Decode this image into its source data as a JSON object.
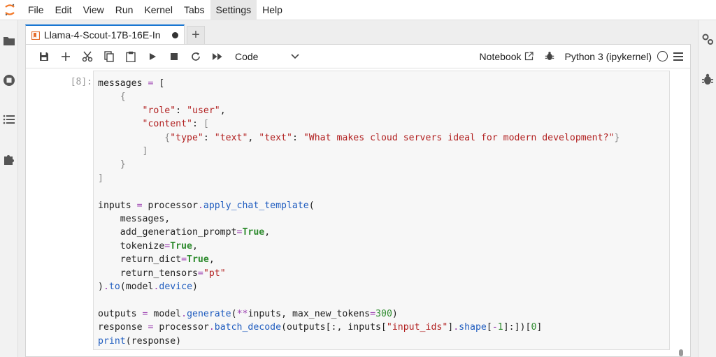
{
  "menubar": {
    "items": [
      "File",
      "Edit",
      "View",
      "Run",
      "Kernel",
      "Tabs",
      "Settings",
      "Help"
    ],
    "active": "Settings"
  },
  "left_sidebar": {
    "icons": [
      "folder-icon",
      "running-icon",
      "toc-icon",
      "extension-icon"
    ]
  },
  "right_sidebar": {
    "icons": [
      "property-inspector-icon",
      "debugger-icon"
    ]
  },
  "tab": {
    "label": "Llama-4-Scout-17B-16E-In",
    "add_label": "+"
  },
  "toolbar": {
    "cell_type": "Code",
    "notebook_label": "Notebook",
    "kernel_name": "Python 3 (ipykernel)"
  },
  "cell": {
    "prompt": "[8]:"
  },
  "colors": {
    "accent": "#1976d2",
    "keyword": "#2e8b2e",
    "string": "#b22222",
    "function": "#1f5cbf",
    "operator": "#9b3fb0"
  }
}
